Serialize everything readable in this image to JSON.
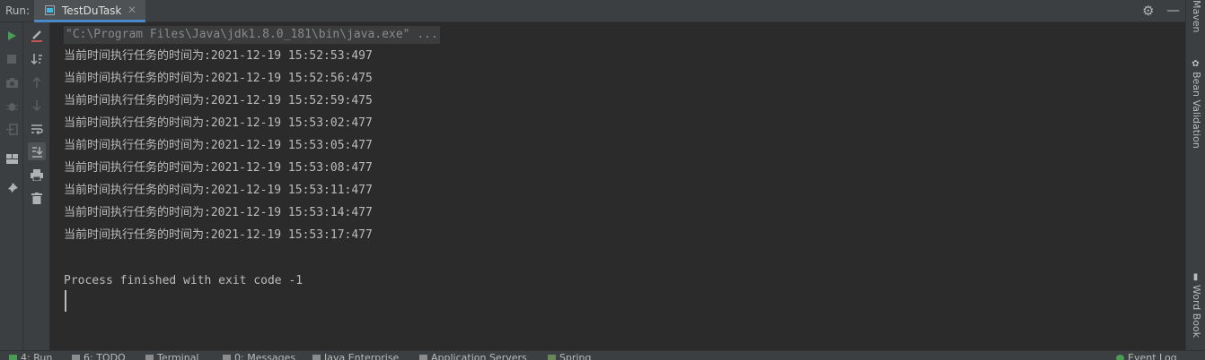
{
  "run_panel": {
    "label": "Run:",
    "tab_title": "TestDuTask"
  },
  "console": {
    "command": "\"C:\\Program Files\\Java\\jdk1.8.0_181\\bin\\java.exe\" ...",
    "lines": [
      "当前时间执行任务的时间为:2021-12-19 15:52:53:497",
      "当前时间执行任务的时间为:2021-12-19 15:52:56:475",
      "当前时间执行任务的时间为:2021-12-19 15:52:59:475",
      "当前时间执行任务的时间为:2021-12-19 15:53:02:477",
      "当前时间执行任务的时间为:2021-12-19 15:53:05:477",
      "当前时间执行任务的时间为:2021-12-19 15:53:08:477",
      "当前时间执行任务的时间为:2021-12-19 15:53:11:477",
      "当前时间执行任务的时间为:2021-12-19 15:53:14:477",
      "当前时间执行任务的时间为:2021-12-19 15:53:17:477"
    ],
    "exit_message": "Process finished with exit code -1"
  },
  "right_sidebar": {
    "tabs": [
      "Maven",
      "Bean Validation",
      "Word Book"
    ]
  },
  "bottom_bar": {
    "tabs": [
      "4: Run",
      "6: TODO",
      "Terminal",
      "0: Messages",
      "Java Enterprise",
      "Application Servers",
      "Spring",
      "Event Log"
    ]
  },
  "colors": {
    "background": "#2b2b2b",
    "panel": "#3c3f41",
    "text": "#bbbbbb",
    "run_green": "#499c54",
    "tab_underline": "#4a88c7"
  },
  "icons": {
    "left_strip": [
      "run-icon",
      "stop-icon",
      "camera-icon",
      "debug-icon",
      "exit-icon",
      "layout-icon",
      "pin-icon"
    ],
    "tool_strip": [
      "clear-icon",
      "sort-icon",
      "up-arrow-icon",
      "down-arrow-icon",
      "soft-wrap-icon",
      "scroll-to-end-icon",
      "print-icon",
      "trash-icon"
    ]
  }
}
